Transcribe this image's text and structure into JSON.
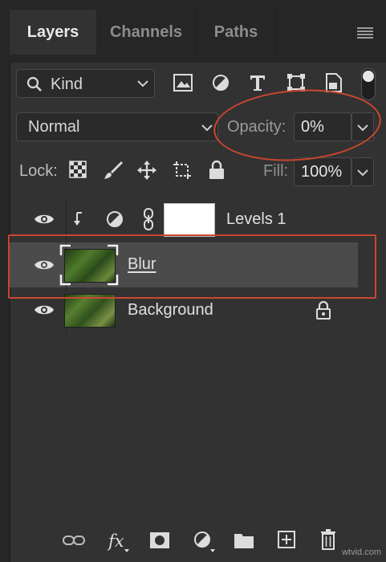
{
  "tabs": [
    {
      "label": "Layers",
      "active": true
    },
    {
      "label": "Channels",
      "active": false
    },
    {
      "label": "Paths",
      "active": false
    }
  ],
  "filter": {
    "kind_label": "Kind",
    "icons": [
      "image-filter-icon",
      "adjustment-filter-icon",
      "type-filter-icon",
      "shape-filter-icon",
      "smart-object-filter-icon"
    ]
  },
  "blend": {
    "mode": "Normal",
    "opacity_label": "Opacity:",
    "opacity_value": "0%",
    "fill_label": "Fill:",
    "fill_value": "100%"
  },
  "lock": {
    "label": "Lock:",
    "icons": [
      "lock-transparent-pixels-icon",
      "lock-image-pixels-icon",
      "lock-position-icon",
      "lock-artboard-icon",
      "lock-all-icon"
    ]
  },
  "layers": [
    {
      "name": "Levels 1",
      "type": "adjustment",
      "visible": true,
      "clipped": true
    },
    {
      "name": "Blur",
      "type": "image",
      "visible": true,
      "selected": true
    },
    {
      "name": "Background",
      "type": "image",
      "visible": true,
      "locked": true
    }
  ],
  "bottom_icons": [
    "link-layers-icon",
    "fx-icon",
    "add-mask-icon",
    "new-adjustment-icon",
    "new-group-icon",
    "new-layer-icon",
    "trash-icon"
  ],
  "watermark": "wtvid.com",
  "colors": {
    "panel_bg": "#323232",
    "highlight": "#c8472f",
    "selected_row": "#4b4b4b"
  }
}
